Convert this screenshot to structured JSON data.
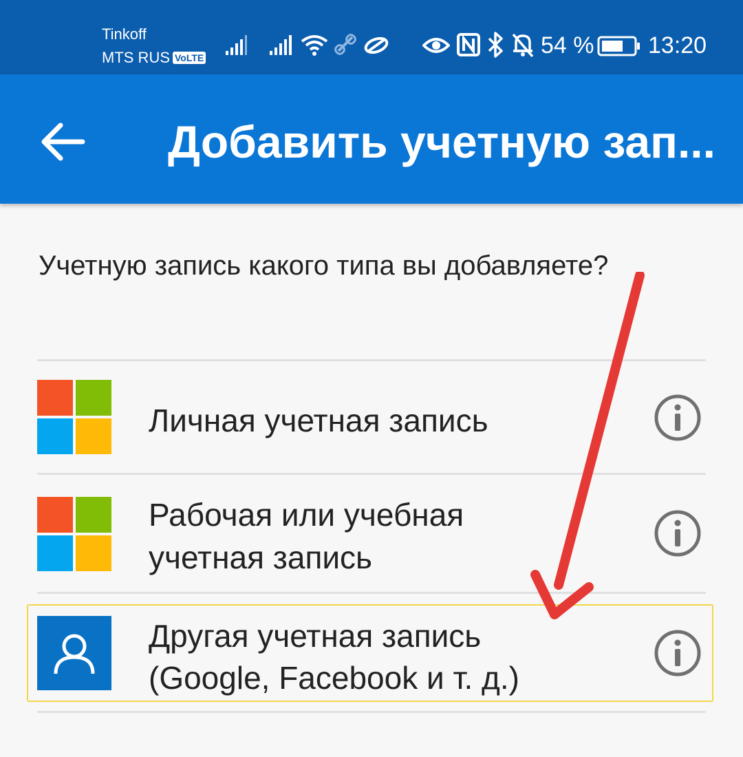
{
  "status_bar": {
    "carrier_1": "Tinkoff",
    "carrier_2": "MTS RUS",
    "volte_badge": "VoLTE",
    "battery_percent": "54 %",
    "time": "13:20",
    "icons": [
      "signal-icon",
      "signal-icon",
      "wifi-icon",
      "link-icon",
      "data-saver-icon",
      "eye-icon",
      "nfc-icon",
      "bluetooth-icon",
      "bell-off-icon",
      "battery-icon"
    ]
  },
  "app_bar": {
    "back_icon": "arrow-left-icon",
    "title": "Добавить учетную зап..."
  },
  "question": "Учетную запись какого типа вы добавляете?",
  "options": [
    {
      "label_line1": "Личная учетная запись",
      "icon": "microsoft-logo-icon",
      "info_icon": "info-icon"
    },
    {
      "label_line1": "Рабочая или учебная",
      "label_line2": "учетная запись",
      "icon": "microsoft-logo-icon",
      "info_icon": "info-icon"
    },
    {
      "label_line1": "Другая учетная запись",
      "label_line2": "(Google, Facebook и т. д.)",
      "icon": "person-icon",
      "info_icon": "info-icon",
      "highlighted": true
    }
  ],
  "colors": {
    "status_bar": "#0b5dae",
    "app_bar": "#0a76d6",
    "background": "#f7f7f7",
    "ms_red": "#f35325",
    "ms_green": "#81bc06",
    "ms_blue": "#05a6f0",
    "ms_yellow": "#ffba08",
    "person_tile": "#0a72c4",
    "highlight_border": "#f2d64a",
    "annotation_arrow": "#e53935"
  },
  "annotation": {
    "icon": "red-arrow-icon"
  }
}
